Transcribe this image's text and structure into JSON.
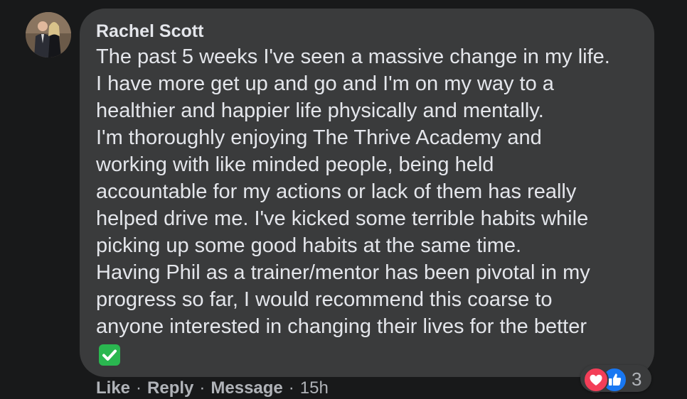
{
  "comment": {
    "author": "Rachel Scott",
    "lines": [
      "The past 5 weeks I've seen a massive change in my life.",
      "I have more get up and go and I'm on my way to a",
      "healthier and happier life physically and mentally.",
      "I'm thoroughly enjoying The Thrive Academy and",
      "working with like minded people, being held",
      "accountable for my actions or lack of them has really",
      "helped drive me. I've kicked some terrible habits while",
      "picking up some good habits at the same time.",
      "Having Phil as a trainer/mentor has been pivotal in my",
      "progress so far, I would recommend this coarse to",
      "anyone interested in changing their lives for the better"
    ],
    "emoji": "white-check-mark-icon"
  },
  "reactions": {
    "icons": [
      "love-icon",
      "like-icon"
    ],
    "count": "3"
  },
  "actions": {
    "like_label": "Like",
    "reply_label": "Reply",
    "message_label": "Message",
    "separator": "·",
    "timestamp": "15h"
  },
  "colors": {
    "background": "#18191a",
    "bubble": "#3a3b3c",
    "text": "#e4e6eb",
    "secondary_text": "#b0b3b8",
    "love": "#f33e58",
    "like": "#1877f2",
    "check": "#2ab750"
  }
}
